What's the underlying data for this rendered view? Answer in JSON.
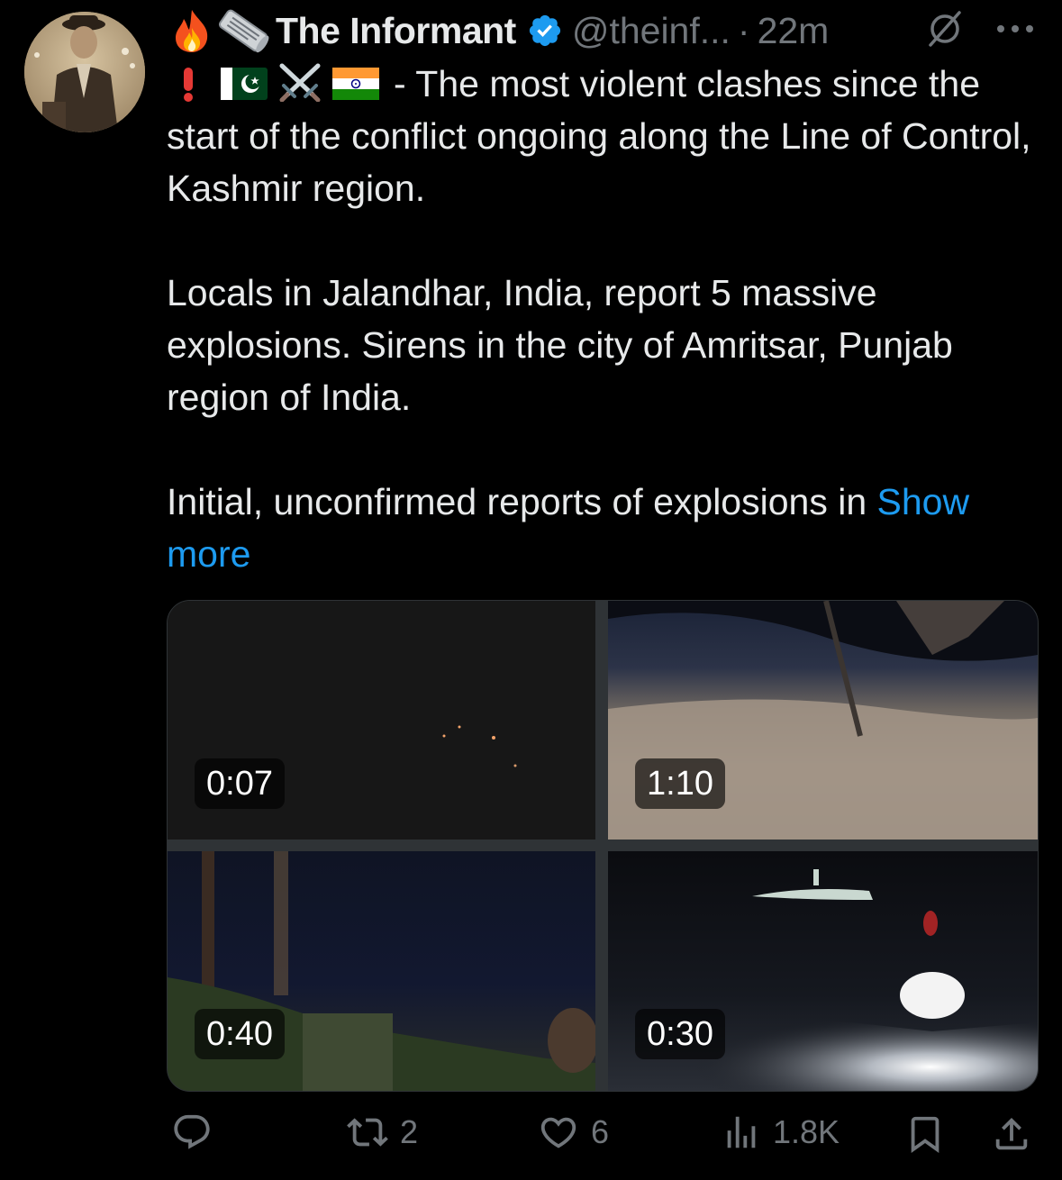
{
  "post": {
    "author_name": "The Informant",
    "handle": "@theinf...",
    "separator": "·",
    "time": "22m",
    "text_line1": "- The most violent clashes since the start of the conflict ongoing along the Line of Control, Kashmir region.",
    "paragraph2": "Locals in Jalandhar, India, report 5 massive explosions. Sirens in the city of Amritsar, Punjab region of India.",
    "paragraph3_start": "Initial, unconfirmed reports of explosions in",
    "show_more": "Show more",
    "name_emojis": [
      "fire",
      "newspaper-roll"
    ],
    "prefix_emojis": [
      "red-exclamation",
      "pakistan-flag",
      "crossed-swords",
      "india-flag"
    ]
  },
  "media": {
    "videos": [
      {
        "duration": "0:07"
      },
      {
        "duration": "1:10"
      },
      {
        "duration": "0:40"
      },
      {
        "duration": "0:30"
      }
    ]
  },
  "actions": {
    "replies": "",
    "reposts": "2",
    "likes": "6",
    "views": "1.8K"
  },
  "colors": {
    "background": "#000000",
    "text": "#e7e9ea",
    "secondary": "#71767b",
    "link": "#1d9bf0",
    "verified": "#1d9bf0"
  },
  "icons": [
    "reply-icon",
    "repost-icon",
    "like-icon",
    "views-icon",
    "bookmark-icon",
    "share-icon",
    "grok-icon",
    "more-icon",
    "verified-badge-icon"
  ]
}
